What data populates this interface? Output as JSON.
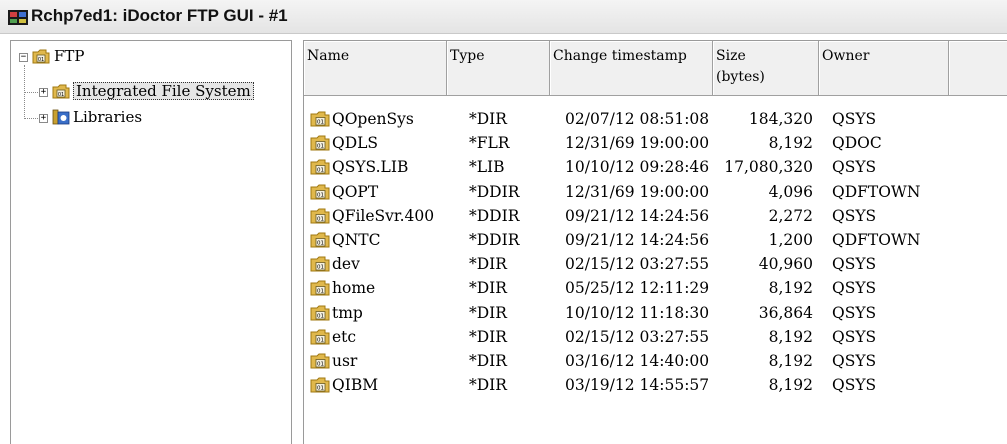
{
  "window": {
    "title": "Rchp7ed1:  iDoctor FTP GUI - #1",
    "icon": "app-window-icon"
  },
  "tree": {
    "root": {
      "label": "FTP",
      "icon": "folder-icon",
      "expanded": true
    },
    "children": [
      {
        "label": "Integrated File System",
        "icon": "folder-icon",
        "expanded": false,
        "selected": true
      },
      {
        "label": "Libraries",
        "icon": "libraries-icon",
        "expanded": false,
        "selected": false
      }
    ]
  },
  "list": {
    "columns": [
      "Name",
      "Type",
      "Change timestamp",
      "Size\n(bytes)",
      "Owner",
      ""
    ],
    "rows": [
      {
        "name": "QOpenSys",
        "type": "*DIR",
        "changed": "02/07/12 08:51:08",
        "size": "184,320",
        "owner": "QSYS"
      },
      {
        "name": "QDLS",
        "type": "*FLR",
        "changed": "12/31/69 19:00:00",
        "size": "8,192",
        "owner": "QDOC"
      },
      {
        "name": "QSYS.LIB",
        "type": "*LIB",
        "changed": "10/10/12 09:28:46",
        "size": "17,080,320",
        "owner": "QSYS"
      },
      {
        "name": "QOPT",
        "type": "*DDIR",
        "changed": "12/31/69 19:00:00",
        "size": "4,096",
        "owner": "QDFTOWN"
      },
      {
        "name": "QFileSvr.400",
        "type": "*DDIR",
        "changed": "09/21/12 14:24:56",
        "size": "2,272",
        "owner": "QSYS"
      },
      {
        "name": "QNTC",
        "type": "*DDIR",
        "changed": "09/21/12 14:24:56",
        "size": "1,200",
        "owner": "QDFTOWN"
      },
      {
        "name": "dev",
        "type": "*DIR",
        "changed": "02/15/12 03:27:55",
        "size": "40,960",
        "owner": "QSYS"
      },
      {
        "name": "home",
        "type": "*DIR",
        "changed": "05/25/12 12:11:29",
        "size": "8,192",
        "owner": "QSYS"
      },
      {
        "name": "tmp",
        "type": "*DIR",
        "changed": "10/10/12 11:18:30",
        "size": "36,864",
        "owner": "QSYS"
      },
      {
        "name": "etc",
        "type": "*DIR",
        "changed": "02/15/12 03:27:55",
        "size": "8,192",
        "owner": "QSYS"
      },
      {
        "name": "usr",
        "type": "*DIR",
        "changed": "03/16/12 14:40:00",
        "size": "8,192",
        "owner": "QSYS"
      },
      {
        "name": "QIBM",
        "type": "*DIR",
        "changed": "03/19/12 14:55:57",
        "size": "8,192",
        "owner": "QSYS"
      }
    ]
  },
  "colors": {
    "folder": "#e0b84c",
    "folder_dark": "#a07810",
    "libraries_blue": "#3a6fc8"
  }
}
